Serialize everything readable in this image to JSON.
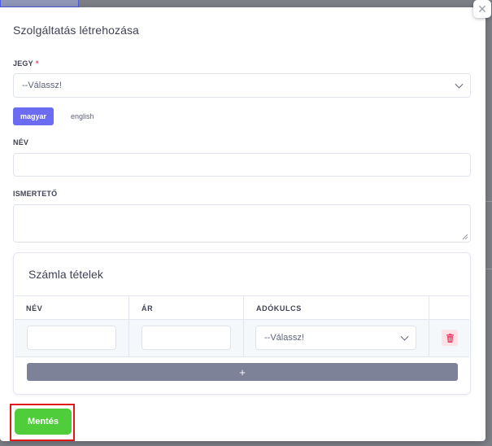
{
  "modal": {
    "title": "Szolgáltatás létrehozása",
    "close_icon": "close-icon"
  },
  "form": {
    "ticket_label": "JEGY",
    "required_mark": "*",
    "ticket_select_value": "--Válassz!",
    "languages": [
      "magyar",
      "english"
    ],
    "active_language": "magyar",
    "name_label": "NÉV",
    "name_value": "",
    "description_label": "ISMERTETŐ",
    "description_value": ""
  },
  "invoice_items": {
    "title": "Számla tételek",
    "columns": [
      "NÉV",
      "ÁR",
      "ADÓKULCS",
      ""
    ],
    "rows": [
      {
        "name": "",
        "price": "",
        "tax_select": "--Válassz!",
        "delete_icon": "trash-icon"
      }
    ],
    "add_label": "+"
  },
  "footer": {
    "save_label": "Mentés"
  },
  "colors": {
    "primary": "#6b6cf2",
    "success": "#50cd3a",
    "danger": "#f1416c",
    "highlight_border": "#e01a1a",
    "muted_button": "#7e8299"
  }
}
